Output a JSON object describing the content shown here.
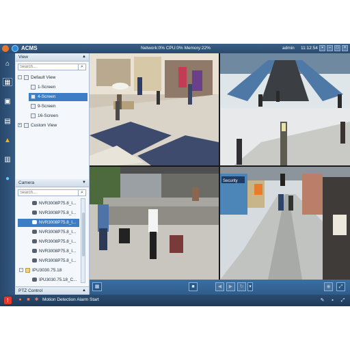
{
  "app": {
    "name": "ACMS",
    "status_text": "Network:0%  CPU:0%  Memory:22%",
    "user": "admin",
    "time": "11:12:54"
  },
  "view_panel": {
    "title": "View",
    "search_placeholder": "Search...",
    "items": [
      {
        "label": "Default View",
        "type": "group"
      },
      {
        "label": "1-Screen",
        "type": "layout"
      },
      {
        "label": "4-Screen",
        "type": "layout",
        "selected": true
      },
      {
        "label": "9-Screen",
        "type": "layout"
      },
      {
        "label": "16-Screen",
        "type": "layout"
      },
      {
        "label": "Custom View",
        "type": "group"
      }
    ]
  },
  "camera_panel": {
    "title": "Camera",
    "search_placeholder": "Search...",
    "cameras": [
      {
        "label": "NVR3008P75.8_I..."
      },
      {
        "label": "NVR3008P75.8_I..."
      },
      {
        "label": "NVR3008P75.8_I...",
        "selected": true
      },
      {
        "label": "NVR3008P75.8_I..."
      },
      {
        "label": "NVR3008P75.8_I..."
      },
      {
        "label": "NVR3008P75.8_I..."
      },
      {
        "label": "NVR3008P75.8_I..."
      }
    ],
    "device": "IPU3030.75.18",
    "device_camera": "IPU3030.75.18_C..."
  },
  "ptz_panel": {
    "title": "PTZ Control"
  },
  "video_tiles": [
    {
      "scene": "shopping-mall-interior"
    },
    {
      "scene": "airport-escalators"
    },
    {
      "scene": "airport-travelers-luggage"
    },
    {
      "scene": "airport-security-corridor",
      "sign": "Security"
    }
  ],
  "status_bar": {
    "message": "Motion Detection Alarm Start"
  },
  "colors": {
    "title_bar": "#2f5278",
    "selection": "#3d7dc6",
    "alarm": "#e23b2d",
    "toolbar": "#336699"
  }
}
